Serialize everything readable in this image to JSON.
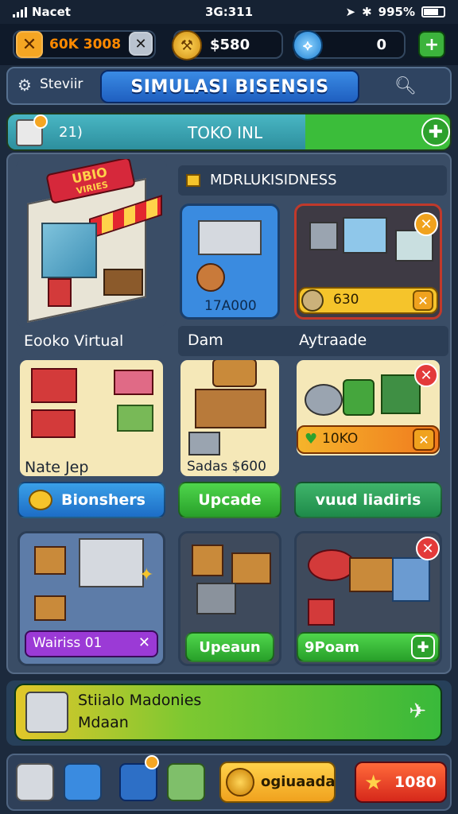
{
  "status_bar": {
    "carrier": "Nacet",
    "time": "3G:311",
    "battery": "995%"
  },
  "resources": {
    "money_primary": "60K 3008",
    "money_secondary": "$580",
    "gems": "0",
    "add_label": "+"
  },
  "header": {
    "title": "SIMULASI BISENSIS",
    "menu_label": "Steviir"
  },
  "shop_bar": {
    "count": "21)",
    "name": "TOKO INL"
  },
  "store": {
    "sign_text": "UBIO",
    "sign_sub": "VIRIES",
    "label": "Eooko Virtual"
  },
  "products_section": {
    "title": "MDRLUKISIDNESS"
  },
  "cards": {
    "c1": {
      "price": "17A000"
    },
    "c2": {
      "price": "630"
    },
    "c3": {
      "label": "Dam"
    },
    "c4": {
      "label": "Aytraade"
    },
    "c5": {
      "label": "Nate Jep"
    },
    "c6": {
      "price": "Sadas $600"
    },
    "c7": {
      "price": "10KO"
    },
    "c8": {
      "badge": "Wairiss 01"
    }
  },
  "buttons": {
    "b1": "Bionshers",
    "b2": "Upcade",
    "b3": "vuud liadiris",
    "b4": "Upeaun",
    "b5": "9Poam"
  },
  "banner": {
    "line1": "Stiialo Madonies",
    "line2": "Mdaan"
  },
  "nav": {
    "gold_label": "ogiuaada",
    "star_label": "1080"
  },
  "colors": {
    "accent_green": "#3bbd3a",
    "accent_blue": "#1f5fc0",
    "accent_red": "#e33a3a",
    "accent_yellow": "#f5c42b"
  }
}
